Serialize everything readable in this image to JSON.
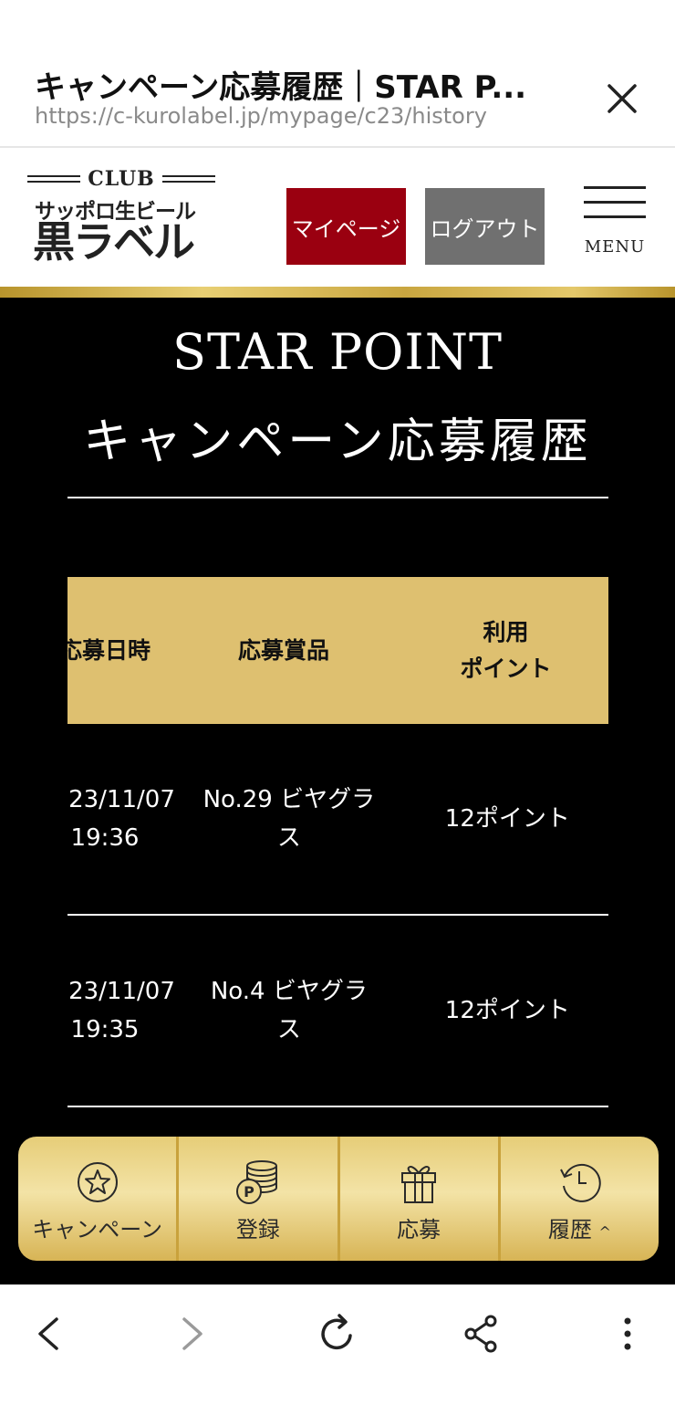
{
  "browser": {
    "title": "キャンペーン応募履歴｜STAR P...",
    "url": "https://c-kurolabel.jp/mypage/c23/history"
  },
  "header": {
    "logo_club": "CLUB",
    "logo_sub": "サッポロ生ビール",
    "logo_main": "黒ラベル",
    "mypage_label": "マイページ",
    "logout_label": "ログアウト",
    "menu_label": "MENU",
    "colors": {
      "mypage": "#9a0010",
      "logout": "#707070",
      "gold": "#dec070"
    }
  },
  "page": {
    "title_en": "STAR POINT",
    "title_jp": "キャンペーン応募履歴"
  },
  "table": {
    "headers": [
      "応募日時",
      "応募賞品",
      "利用\nポイント"
    ],
    "rows": [
      {
        "date": "2023/11/07",
        "time": "19:36",
        "prize_line1": "No.29 ビヤグラ",
        "prize_line2": "ス",
        "points": "12ポイント"
      },
      {
        "date": "2023/11/07",
        "time": "19:35",
        "prize_line1": "No.4 ビヤグラ",
        "prize_line2": "ス",
        "points": "12ポイント"
      }
    ]
  },
  "bottom_nav": [
    {
      "label": "キャンペーン",
      "icon": "star-circle-icon"
    },
    {
      "label": "登録",
      "icon": "coin-stack-icon"
    },
    {
      "label": "応募",
      "icon": "gift-icon"
    },
    {
      "label": "履歴",
      "icon": "history-clock-icon"
    }
  ]
}
